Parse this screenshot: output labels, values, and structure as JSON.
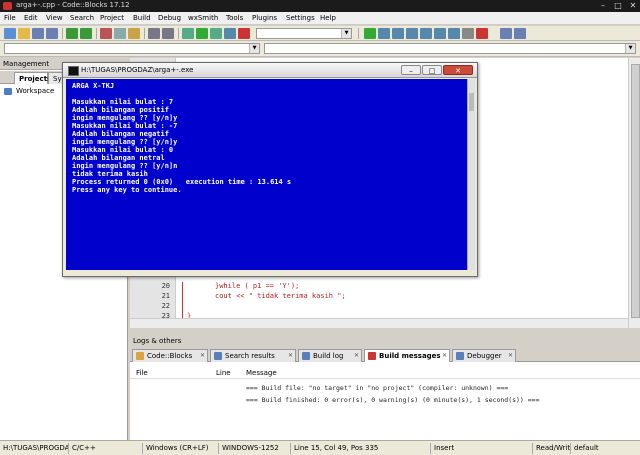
{
  "window": {
    "title": "arga+-.cpp - Code::Blocks 17.12",
    "minimize": "–",
    "maximize": "□",
    "close": "✕"
  },
  "menu": [
    "File",
    "Edit",
    "View",
    "Search",
    "Project",
    "Build",
    "Debug",
    "wxSmith",
    "Tools",
    "Plugins",
    "Settings",
    "Help"
  ],
  "management": {
    "title": "Management",
    "tabs": [
      "Projects",
      "Sy"
    ],
    "tree_root": "Workspace"
  },
  "editor": {
    "lines": [
      {
        "no": "20",
        "code": "}while ( p1 == 'Y');"
      },
      {
        "no": "21",
        "code": "cout << \" tidak terima kasih \";"
      },
      {
        "no": "22",
        "code": ""
      },
      {
        "no": "23",
        "code": "}"
      }
    ]
  },
  "console": {
    "title": "H:\\TUGAS\\PROGDAZ\\arga+-.exe",
    "minimize": "–",
    "maximize": "□",
    "close": "✕",
    "lines": [
      "ARGA X-TKJ",
      "",
      "Masukkan nilai bulat : 7",
      "Adalah bilangan positif",
      "ingin mengulang ?? [y/n]y",
      "Masukkan nilai bulat : -7",
      "Adalah bilangan negatif",
      "ingin mengulang ?? [y/n]y",
      "Masukkan nilai bulat : 0",
      "Adalah bilangan netral",
      "ingin mengulang ?? [y/n]n",
      "tidak terima kasih",
      "Process returned 0 (0x0)   execution time : 13.614 s",
      "Press any key to continue."
    ]
  },
  "logs": {
    "title": "Logs & others",
    "tabs": [
      "Code::Blocks",
      "Search results",
      "Build log",
      "Build messages",
      "Debugger"
    ],
    "active_tab": "Build messages",
    "columns": [
      "File",
      "Line",
      "Message"
    ],
    "messages": [
      "=== Build file: \"no target\" in \"no project\" (compiler: unknown) ===",
      "=== Build finished: 0 error(s), 0 warning(s) (0 minute(s), 1 second(s)) ==="
    ]
  },
  "status": [
    "H:\\TUGAS\\PROGDA",
    "C/C++",
    "Windows (CR+LF)",
    "WINDOWS-1252",
    "Line 15, Col 49, Pos 335",
    "Insert",
    "Read/Write",
    "default"
  ]
}
